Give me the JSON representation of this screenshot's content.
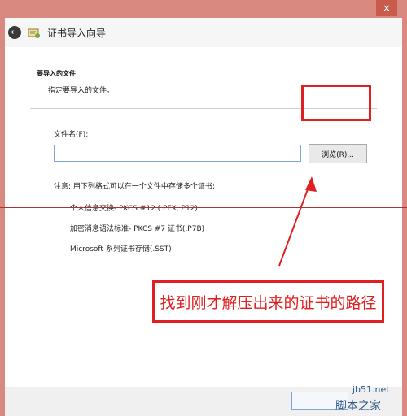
{
  "window": {
    "close_icon": "×",
    "back_icon": "←",
    "title": "证书导入向导"
  },
  "section": {
    "title": "要导入的文件",
    "description": "指定要导入的文件。"
  },
  "file": {
    "label": "文件名(F):",
    "value": "",
    "browse_label": "浏览(R)..."
  },
  "formats": {
    "note": "注意: 用下列格式可以在一个文件中存储多个证书:",
    "items": [
      "个人信息交换- PKCS #12 (.PFX,.P12)",
      "加密消息语法标准- PKCS #7 证书(.P7B)",
      "Microsoft 系列证书存储(.SST)"
    ]
  },
  "annotation": {
    "callout": "找到刚才解压出来的证书的路径",
    "color": "#e02020"
  },
  "watermark": {
    "url": "jb51.net",
    "text": "脚本之家"
  }
}
